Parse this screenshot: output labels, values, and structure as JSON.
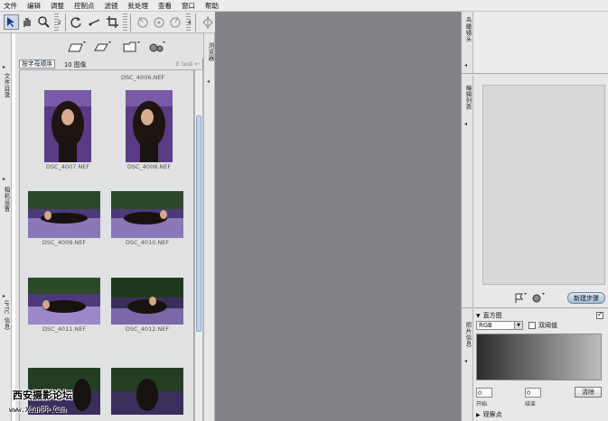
{
  "menu": [
    "文件",
    "编辑",
    "调整",
    "控制点",
    "滤镜",
    "批处理",
    "查看",
    "窗口",
    "帮助"
  ],
  "toolbar_groups": [
    "2",
    "4",
    "5",
    "6"
  ],
  "left_tabs": [
    "文件目录",
    "相机设置",
    "IPTC 信息"
  ],
  "browser_tab": "浏览器",
  "sort": {
    "label": "按字母顺序",
    "count": "10 图像",
    "filter": "E test ←"
  },
  "images": [
    {
      "name": "DSC_4006.NEF"
    },
    {
      "name": "DSC_4007.NEF"
    },
    {
      "name": "DSC_4008.NEF"
    },
    {
      "name": "DSC_4009.NEF"
    },
    {
      "name": "DSC_4010.NEF"
    },
    {
      "name": "DSC_4011.NEF"
    },
    {
      "name": "DSC_4012.NEF"
    }
  ],
  "right_tabs": [
    "鸟瞰镜头",
    "编辑列表",
    "照片信息"
  ],
  "edit_list": {
    "new_step": "新建步骤"
  },
  "histogram": {
    "title": "直方图",
    "channel": "RGB",
    "threshold_label": "双阈值",
    "start_value": "0",
    "end_value": "0",
    "start_label": "开始",
    "end_label": "结束",
    "clear": "清除",
    "watch_points": "观察点"
  },
  "watermark": {
    "line1": "西安摄影论坛",
    "line2": "www.XianPP.Com"
  }
}
